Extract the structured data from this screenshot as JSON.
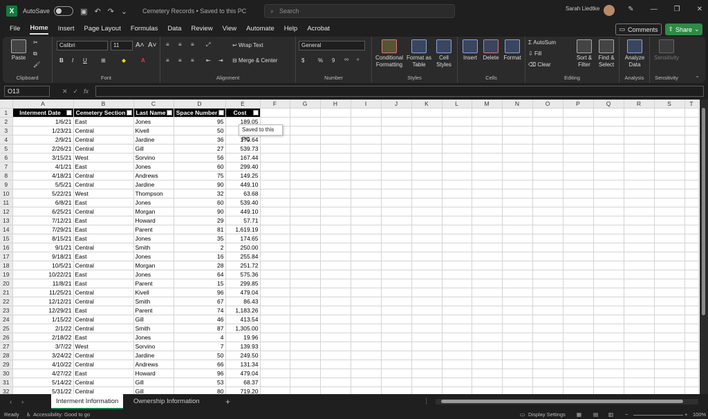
{
  "titlebar": {
    "autosave_label": "AutoSave",
    "autosave_state": "Off",
    "doc_title": "Cemetery Records  •  Saved to this PC",
    "search_placeholder": "Search",
    "user_name": "Sarah Liedtke"
  },
  "menu": {
    "tabs": [
      "File",
      "Home",
      "Insert",
      "Page Layout",
      "Formulas",
      "Data",
      "Review",
      "View",
      "Automate",
      "Help",
      "Acrobat"
    ],
    "active": "Home",
    "comments_label": "Comments",
    "share_label": "Share"
  },
  "ribbon": {
    "clipboard": {
      "paste": "Paste",
      "label": "Clipboard"
    },
    "font": {
      "family": "Calibri",
      "size": "11",
      "label": "Font"
    },
    "alignment": {
      "wrap": "Wrap Text",
      "merge": "Merge & Center",
      "label": "Alignment"
    },
    "number": {
      "format": "General",
      "label": "Number"
    },
    "styles": {
      "conditional": "Conditional Formatting",
      "format_table": "Format as Table",
      "cell_styles": "Cell Styles",
      "label": "Styles"
    },
    "cells": {
      "insert": "Insert",
      "delete": "Delete",
      "format": "Format",
      "label": "Cells"
    },
    "editing": {
      "autosum": "AutoSum",
      "fill": "Fill",
      "clear": "Clear",
      "sort": "Sort & Filter",
      "find": "Find & Select",
      "label": "Editing"
    },
    "analysis": {
      "analyze": "Analyze Data",
      "label": "Analysis"
    },
    "sensitivity": {
      "btn": "Sensitivity",
      "label": "Sensitivity"
    }
  },
  "formula_bar": {
    "name_box": "O13",
    "fx": "fx",
    "content": ""
  },
  "grid": {
    "columns": [
      "A",
      "B",
      "C",
      "D",
      "E",
      "F",
      "G",
      "H",
      "I",
      "J",
      "K",
      "L",
      "M",
      "N",
      "O",
      "P",
      "Q",
      "R",
      "S",
      "T"
    ],
    "headers": [
      "Interment Date",
      "Cemetery Section",
      "Last Name",
      "Space Number",
      "Cost"
    ],
    "rows": [
      [
        "1/6/21",
        "East",
        "Jones",
        "95",
        "189.05"
      ],
      [
        "1/23/21",
        "Central",
        "Kivell",
        "50",
        ""
      ],
      [
        "2/9/21",
        "Central",
        "Jardine",
        "36",
        "179.64"
      ],
      [
        "2/26/21",
        "Central",
        "Gill",
        "27",
        "539.73"
      ],
      [
        "3/15/21",
        "West",
        "Sorvino",
        "56",
        "167.44"
      ],
      [
        "4/1/21",
        "East",
        "Jones",
        "60",
        "299.40"
      ],
      [
        "4/18/21",
        "Central",
        "Andrews",
        "75",
        "149.25"
      ],
      [
        "5/5/21",
        "Central",
        "Jardine",
        "90",
        "449.10"
      ],
      [
        "5/22/21",
        "West",
        "Thompson",
        "32",
        "63.68"
      ],
      [
        "6/8/21",
        "East",
        "Jones",
        "60",
        "539.40"
      ],
      [
        "6/25/21",
        "Central",
        "Morgan",
        "90",
        "449.10"
      ],
      [
        "7/12/21",
        "East",
        "Howard",
        "29",
        "57.71"
      ],
      [
        "7/29/21",
        "East",
        "Parent",
        "81",
        "1,619.19"
      ],
      [
        "8/15/21",
        "East",
        "Jones",
        "35",
        "174.65"
      ],
      [
        "9/1/21",
        "Central",
        "Smith",
        "2",
        "250.00"
      ],
      [
        "9/18/21",
        "East",
        "Jones",
        "16",
        "255.84"
      ],
      [
        "10/5/21",
        "Central",
        "Morgan",
        "28",
        "251.72"
      ],
      [
        "10/22/21",
        "East",
        "Jones",
        "64",
        "575.36"
      ],
      [
        "11/8/21",
        "East",
        "Parent",
        "15",
        "299.85"
      ],
      [
        "11/25/21",
        "Central",
        "Kivell",
        "96",
        "479.04"
      ],
      [
        "12/12/21",
        "Central",
        "Smith",
        "67",
        "86.43"
      ],
      [
        "12/29/21",
        "East",
        "Parent",
        "74",
        "1,183.26"
      ],
      [
        "1/15/22",
        "Central",
        "Gill",
        "46",
        "413.54"
      ],
      [
        "2/1/22",
        "Central",
        "Smith",
        "87",
        "1,305.00"
      ],
      [
        "2/18/22",
        "East",
        "Jones",
        "4",
        "19.96"
      ],
      [
        "3/7/22",
        "West",
        "Sorvino",
        "7",
        "139.93"
      ],
      [
        "3/24/22",
        "Central",
        "Jardine",
        "50",
        "249.50"
      ],
      [
        "4/10/22",
        "Central",
        "Andrews",
        "66",
        "131.34"
      ],
      [
        "4/27/22",
        "East",
        "Howard",
        "96",
        "479.04"
      ],
      [
        "5/14/22",
        "Central",
        "Gill",
        "53",
        "68.37"
      ],
      [
        "5/31/22",
        "Central",
        "Gill",
        "80",
        "719.20"
      ]
    ],
    "tooltip": "Saved to this PC"
  },
  "sheets": {
    "tabs": [
      "Interment Information",
      "Ownership Information"
    ],
    "active": 0,
    "add": "+"
  },
  "status": {
    "ready": "Ready",
    "accessibility": "Accessibility: Good to go",
    "display": "Display Settings",
    "zoom": "100%"
  }
}
